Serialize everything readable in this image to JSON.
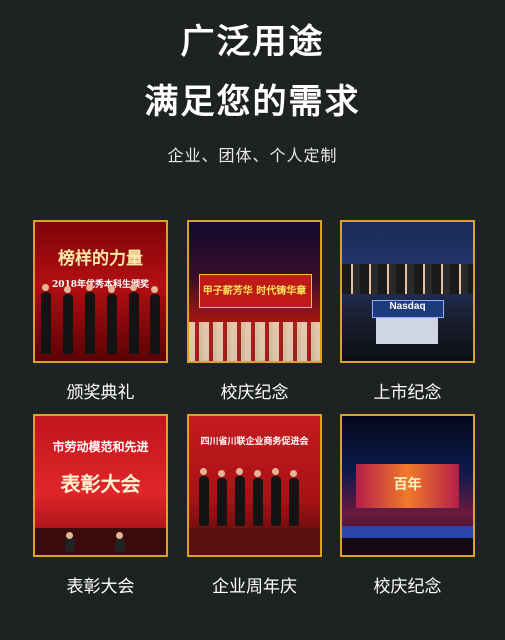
{
  "header": {
    "title_line1": "广泛用途",
    "title_line2": "满足您的需求",
    "subtitle": "企业、团体、个人定制"
  },
  "cards": [
    {
      "caption": "颁奖典礼",
      "photo_text_a": "榜样的力量",
      "photo_text_b": "2018年优秀本科生颁奖"
    },
    {
      "caption": "校庆纪念",
      "photo_text_a": "甲子薪芳华  时代铸华章"
    },
    {
      "caption": "上市纪念",
      "photo_text_a": "Nasdaq"
    },
    {
      "caption": "表彰大会",
      "photo_text_a": "市劳动模范和先进",
      "photo_text_b": "表彰大会"
    },
    {
      "caption": "企业周年庆",
      "photo_text_a": "四川省川联企业商务促进会"
    },
    {
      "caption": "校庆纪念",
      "photo_text_a": "百年"
    }
  ],
  "colors": {
    "background": "#1f2223",
    "frame": "#d9a521",
    "text": "#ffffff"
  }
}
